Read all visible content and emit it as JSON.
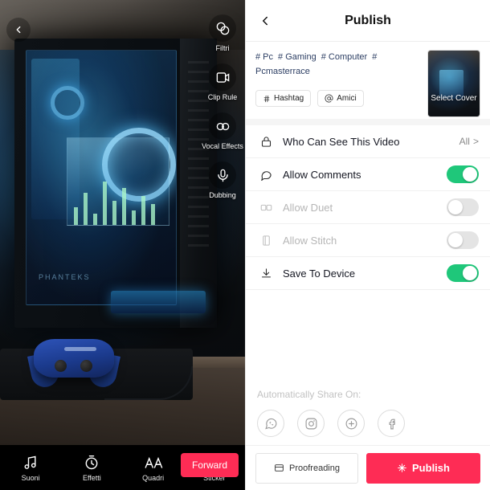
{
  "editor": {
    "back_icon": "chevron-left-icon",
    "tools": [
      {
        "icon": "filters-icon",
        "label": "Filtri"
      },
      {
        "icon": "clip-adjust-icon",
        "label": "Clip Rule"
      },
      {
        "icon": "voice-effects-icon",
        "label": "Vocal Effects"
      },
      {
        "icon": "microphone-icon",
        "label": "Dubbing"
      }
    ],
    "bottom_tools": [
      {
        "icon": "music-note-icon",
        "label": "Suoni"
      },
      {
        "icon": "timer-icon",
        "label": "Effetti"
      },
      {
        "icon": "text-icon",
        "label": "Quadri"
      },
      {
        "icon": "sticker-icon",
        "label": "Sticker"
      }
    ],
    "forward_label": "Forward"
  },
  "publish": {
    "header": {
      "back_icon": "chevron-left-icon",
      "title": "Publish"
    },
    "compose": {
      "tags": [
        "# Pc",
        "# Gaming",
        "# Computer",
        "# Pcmasterrace"
      ],
      "chips": [
        {
          "icon": "hashtag-icon",
          "label": "Hashtag"
        },
        {
          "icon": "at-icon",
          "label": "Amici"
        }
      ],
      "cover_label": "Select Cover"
    },
    "rows": [
      {
        "icon": "lock-icon",
        "label": "Who Can See This Video",
        "type": "value",
        "value": "All",
        "chevron": ">",
        "dim": false
      },
      {
        "icon": "comment-icon",
        "label": "Allow Comments",
        "type": "toggle",
        "on": true,
        "dim": false
      },
      {
        "icon": "duet-icon",
        "label": "Allow Duet",
        "type": "toggle",
        "on": false,
        "dim": true
      },
      {
        "icon": "stitch-icon",
        "label": "Allow Stitch",
        "type": "toggle",
        "on": false,
        "dim": true
      },
      {
        "icon": "download-icon",
        "label": "Save To Device",
        "type": "toggle",
        "on": true,
        "dim": false
      }
    ],
    "share": {
      "title": "Automatically Share On:",
      "items": [
        {
          "icon": "whatsapp-icon",
          "name": "WhatsApp"
        },
        {
          "icon": "instagram-icon",
          "name": "Instagram"
        },
        {
          "icon": "more-icon",
          "name": "More"
        },
        {
          "icon": "facebook-icon",
          "name": "Facebook"
        }
      ]
    },
    "footer": {
      "draft_icon": "drafts-icon",
      "draft_label": "Proofreading",
      "publish_icon": "sparkle-icon",
      "publish_label": "Publish"
    }
  },
  "colors": {
    "accent": "#fe2c55",
    "toggle_on": "#1fc77a",
    "toggle_off": "#e4e4e4",
    "text_primary": "#161823",
    "text_dim": "#b6b6b6"
  }
}
